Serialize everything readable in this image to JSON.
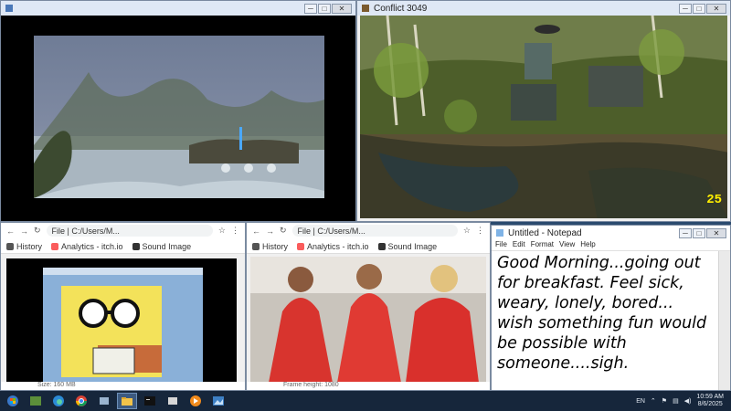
{
  "windows": {
    "video_player": {
      "title": ""
    },
    "game": {
      "title": "Conflict 3049",
      "fps": "25"
    },
    "browser_left": {
      "address": "File | C:/Users/M...",
      "bookmarks": [
        "History",
        "Analytics - itch.io",
        "Sound Image"
      ],
      "status": "Size: 160 MB"
    },
    "browser_right": {
      "address": "File | C:/Users/M...",
      "bookmarks": [
        "History",
        "Analytics - itch.io",
        "Sound Image"
      ],
      "status": "Frame height: 1080"
    },
    "notepad": {
      "title": "Untitled - Notepad",
      "menu": [
        "File",
        "Edit",
        "Format",
        "View",
        "Help"
      ],
      "text": "Good Morning...going out for breakfast. Feel sick, weary, lonely, bored... wish something fun would be possible with someone....sigh."
    }
  },
  "taskbar": {
    "apps": [
      "start-icon",
      "game-launcher-icon",
      "edge-icon",
      "chrome-icon",
      "window-icon",
      "folder-icon",
      "terminal-icon",
      "window-icon",
      "media-icon",
      "photos-icon"
    ],
    "tray": {
      "lang": "EN",
      "time": "10:59 AM",
      "date": "8/6/2025"
    }
  }
}
